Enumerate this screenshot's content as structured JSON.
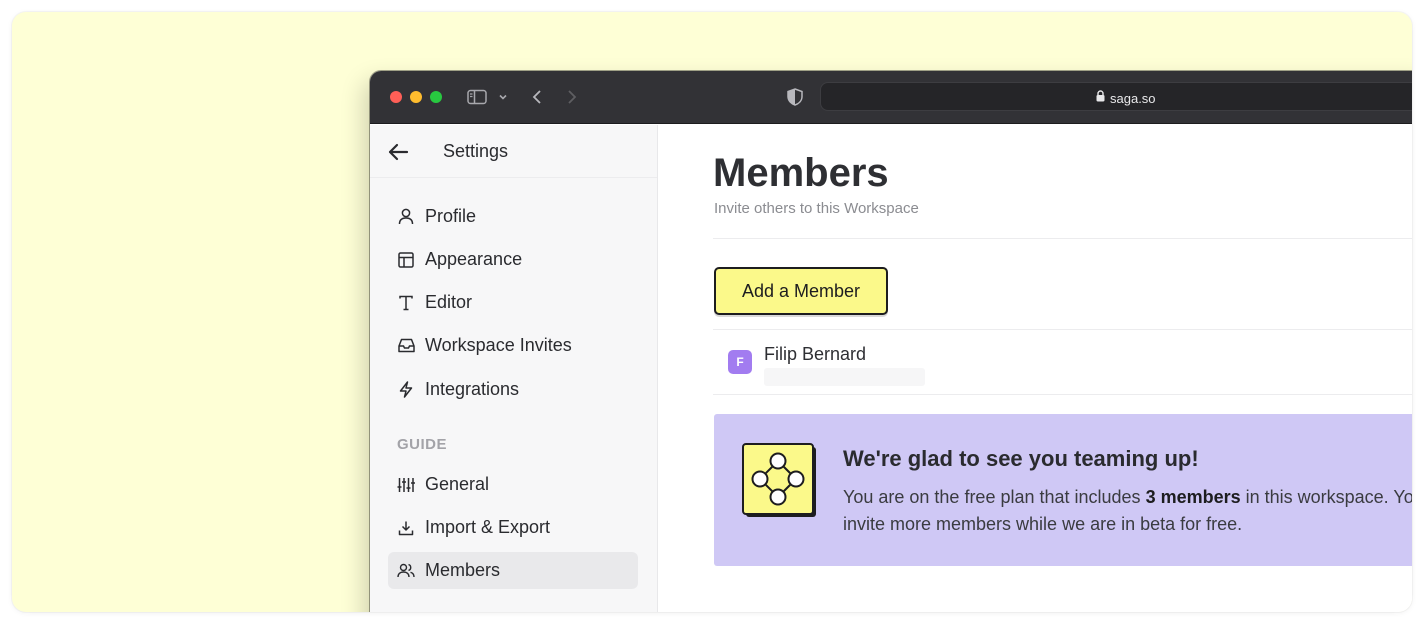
{
  "colors": {
    "canvas": "#feffd6",
    "titlebar": "#323236",
    "accent_button": "#fbf98a",
    "banner": "#cfc8f5",
    "avatar": "#a27cf0"
  },
  "browser": {
    "url": "saga.so",
    "icons": [
      "sidebar-icon",
      "chevron-down-icon",
      "back-icon",
      "forward-icon",
      "shield-icon",
      "lock-icon"
    ]
  },
  "sidebar": {
    "title": "Settings",
    "items": [
      {
        "label": "Profile",
        "icon": "user-icon"
      },
      {
        "label": "Appearance",
        "icon": "layout-icon"
      },
      {
        "label": "Editor",
        "icon": "text-icon"
      },
      {
        "label": "Workspace Invites",
        "icon": "inbox-icon"
      },
      {
        "label": "Integrations",
        "icon": "bolt-icon"
      }
    ],
    "section_label": "GUIDE",
    "guide_items": [
      {
        "label": "General",
        "icon": "sliders-icon"
      },
      {
        "label": "Import & Export",
        "icon": "download-icon"
      },
      {
        "label": "Members",
        "icon": "users-icon",
        "active": true
      }
    ]
  },
  "main": {
    "title": "Members",
    "subtitle": "Invite others to this Workspace",
    "add_button": "Add a Member",
    "members": [
      {
        "initial": "F",
        "name": "Filip Bernard"
      }
    ],
    "banner": {
      "title": "We're glad to see you teaming up!",
      "body_pre": "You are on the free plan that includes ",
      "body_bold": "3 members",
      "body_post": " in this workspace. You can",
      "body_line2": "invite more members while we are in beta for free."
    }
  }
}
